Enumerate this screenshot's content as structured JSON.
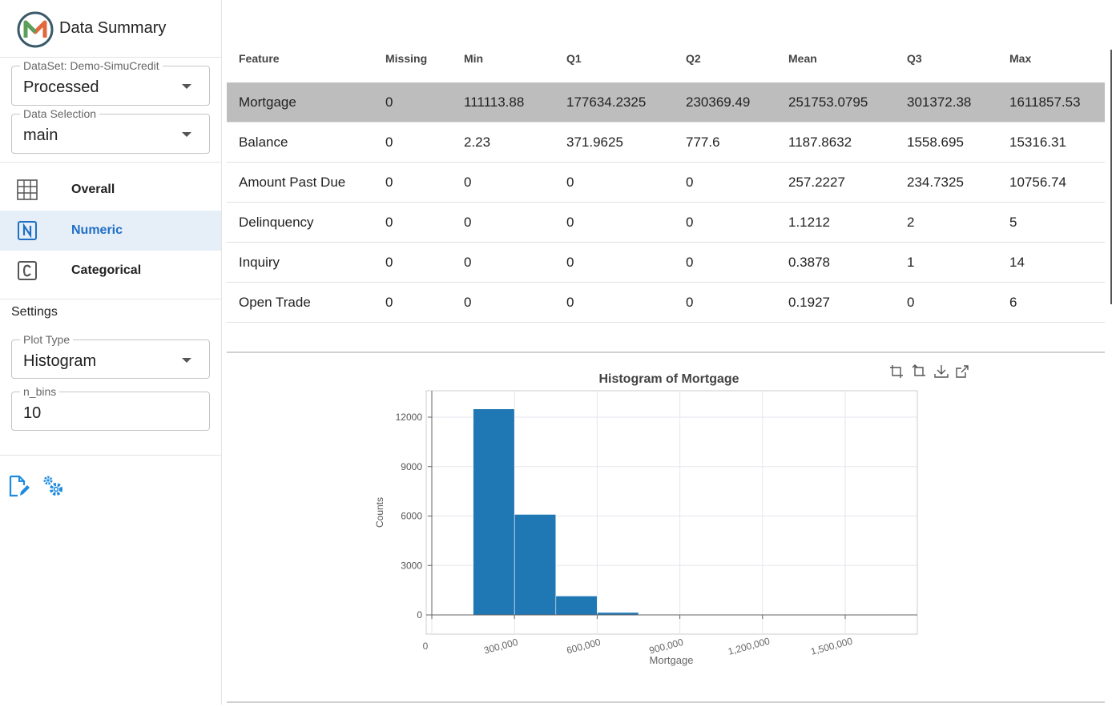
{
  "app": {
    "title": "Data Summary"
  },
  "sidebar": {
    "dataset": {
      "legend": "DataSet: Demo-SimuCredit",
      "value": "Processed"
    },
    "selection": {
      "legend": "Data Selection",
      "value": "main"
    },
    "nav": [
      {
        "label": "Overall",
        "icon": "grid-icon"
      },
      {
        "label": "Numeric",
        "icon": "numeric-n-icon",
        "active": true
      },
      {
        "label": "Categorical",
        "icon": "categorical-c-icon"
      }
    ],
    "settings_title": "Settings",
    "plot_type": {
      "legend": "Plot Type",
      "value": "Histogram"
    },
    "n_bins": {
      "legend": "n_bins",
      "value": "10"
    }
  },
  "table": {
    "headers": [
      "Feature",
      "Missing",
      "Min",
      "Q1",
      "Q2",
      "Mean",
      "Q3",
      "Max"
    ],
    "rows": [
      [
        "Mortgage",
        "0",
        "111113.88",
        "177634.2325",
        "230369.49",
        "251753.0795",
        "301372.38",
        "1611857.53"
      ],
      [
        "Balance",
        "0",
        "2.23",
        "371.9625",
        "777.6",
        "1187.8632",
        "1558.695",
        "15316.31"
      ],
      [
        "Amount Past Due",
        "0",
        "0",
        "0",
        "0",
        "257.2227",
        "234.7325",
        "10756.74"
      ],
      [
        "Delinquency",
        "0",
        "0",
        "0",
        "0",
        "1.1212",
        "2",
        "5"
      ],
      [
        "Inquiry",
        "0",
        "0",
        "0",
        "0",
        "0.3878",
        "1",
        "14"
      ],
      [
        "Open Trade",
        "0",
        "0",
        "0",
        "0",
        "0.1927",
        "0",
        "6"
      ]
    ],
    "selected_row": 0
  },
  "colors": {
    "accent": "#1f6fc5",
    "bar": "#1f77b4",
    "selected_row": "#bdbdbd",
    "nav_active_bg": "#e6eef8"
  },
  "chart_data": {
    "type": "bar",
    "title": "Histogram of Mortgage",
    "xlabel": "Mortgage",
    "ylabel": "Counts",
    "xlim": [
      0,
      1800000
    ],
    "ylim": [
      0,
      13500
    ],
    "xticks": [
      "0",
      "300,000",
      "600,000",
      "900,000",
      "1,200,000",
      "1,500,000"
    ],
    "xtick_values": [
      0,
      300000,
      600000,
      900000,
      1200000,
      1500000
    ],
    "yticks": [
      "0",
      "3000",
      "6000",
      "9000",
      "12000"
    ],
    "ytick_values": [
      0,
      3000,
      6000,
      9000,
      12000
    ],
    "bins": [
      {
        "x0": 150000,
        "x1": 300000,
        "count": 12500
      },
      {
        "x0": 300000,
        "x1": 450000,
        "count": 6100
      },
      {
        "x0": 450000,
        "x1": 600000,
        "count": 1150
      },
      {
        "x0": 600000,
        "x1": 750000,
        "count": 150
      },
      {
        "x0": 750000,
        "x1": 900000,
        "count": 30
      },
      {
        "x0": 900000,
        "x1": 1050000,
        "count": 10
      },
      {
        "x0": 1050000,
        "x1": 1200000,
        "count": 5
      },
      {
        "x0": 1200000,
        "x1": 1350000,
        "count": 3
      },
      {
        "x0": 1350000,
        "x1": 1500000,
        "count": 2
      },
      {
        "x0": 1500000,
        "x1": 1650000,
        "count": 1
      }
    ],
    "grid": true,
    "toolbox": [
      "zoom-icon",
      "zoom-reset-icon",
      "download-icon",
      "open-external-icon"
    ]
  }
}
